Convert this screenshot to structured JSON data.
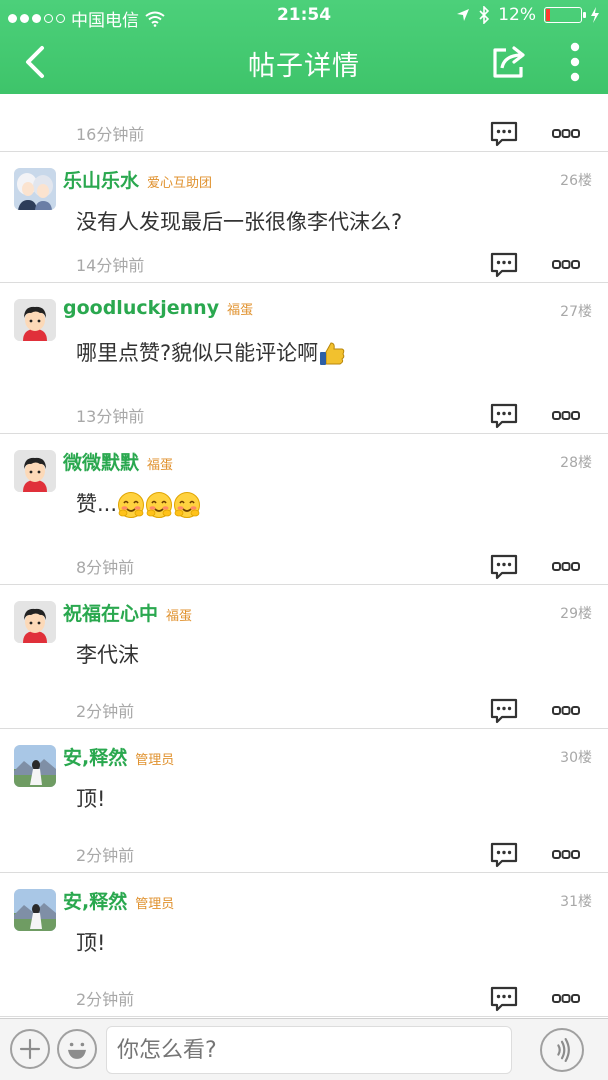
{
  "status_bar": {
    "carrier": "中国电信",
    "time": "21:54",
    "battery_percent": "12%",
    "battery_level": 0.12
  },
  "nav": {
    "title": "帖子详情"
  },
  "partial_post": {
    "time": "16分钟前"
  },
  "posts": [
    {
      "username": "乐山乐水",
      "badge": "爱心互助团",
      "floor": "26楼",
      "content": "没有人发现最后一张很像李代沫么?",
      "time": "14分钟前",
      "avatar": "anime-avatar-icon",
      "emoji": ""
    },
    {
      "username": "goodluckjenny",
      "badge": "福蛋",
      "floor": "27楼",
      "content": "哪里点赞?貌似只能评论啊",
      "time": "13分钟前",
      "avatar": "default-avatar-icon",
      "emoji": "thumbs-up-emoji"
    },
    {
      "username": "微微默默",
      "badge": "福蛋",
      "floor": "28楼",
      "content": "赞...",
      "time": "8分钟前",
      "avatar": "default-avatar-icon",
      "emoji": "blushing-smile-emoji x3"
    },
    {
      "username": "祝福在心中",
      "badge": "福蛋",
      "floor": "29楼",
      "content": "李代沫",
      "time": "2分钟前",
      "avatar": "default-avatar-icon",
      "emoji": ""
    },
    {
      "username": "安,释然",
      "badge": "管理员",
      "floor": "30楼",
      "content": "顶!",
      "time": "2分钟前",
      "avatar": "photo-avatar-icon",
      "emoji": ""
    },
    {
      "username": "安,释然",
      "badge": "管理员",
      "floor": "31楼",
      "content": "顶!",
      "time": "2分钟前",
      "avatar": "photo-avatar-icon",
      "emoji": ""
    }
  ],
  "bottom_bar": {
    "input_placeholder": "你怎么看?"
  },
  "colors": {
    "header_green": "#3ec46a",
    "username_green": "#2aa84f",
    "badge_orange": "#e0922f",
    "meta_gray": "#a8a8a8"
  }
}
